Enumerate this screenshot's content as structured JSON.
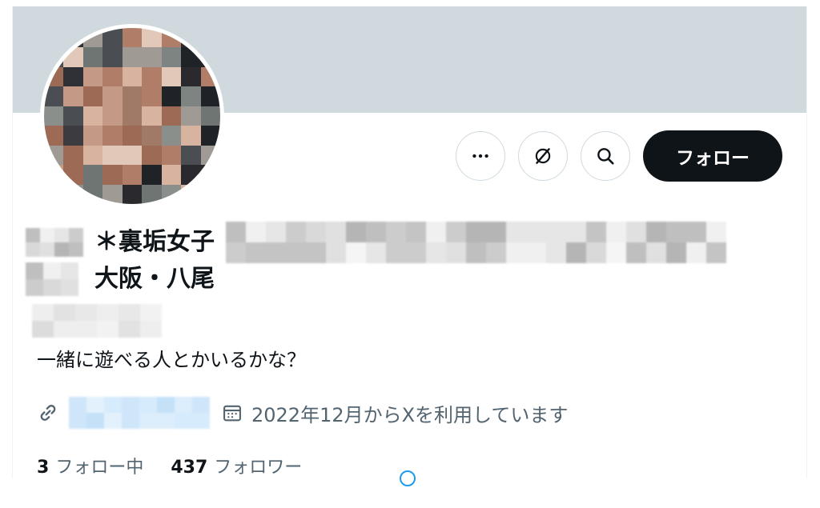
{
  "profile": {
    "display_name_line1": "＊裏垢女子",
    "display_name_line2": "大阪・八尾",
    "bio": "一緒に遊べる人とかいるかな？",
    "joined": "2022年12月からXを利用しています",
    "following_count": "3",
    "following_label": "フォロー中",
    "followers_count": "437",
    "followers_label": "フォロワー"
  },
  "actions": {
    "more_icon": "more-horizontal-icon",
    "grok_icon": "grok-icon",
    "search_icon": "search-icon",
    "follow_label": "フォロー"
  },
  "icons": {
    "link": "link-icon",
    "calendar": "calendar-icon"
  },
  "colors": {
    "banner": "#cfd9de",
    "follow_button": "#0f1419",
    "secondary_text": "#536471",
    "accent": "#1d9bf0"
  }
}
